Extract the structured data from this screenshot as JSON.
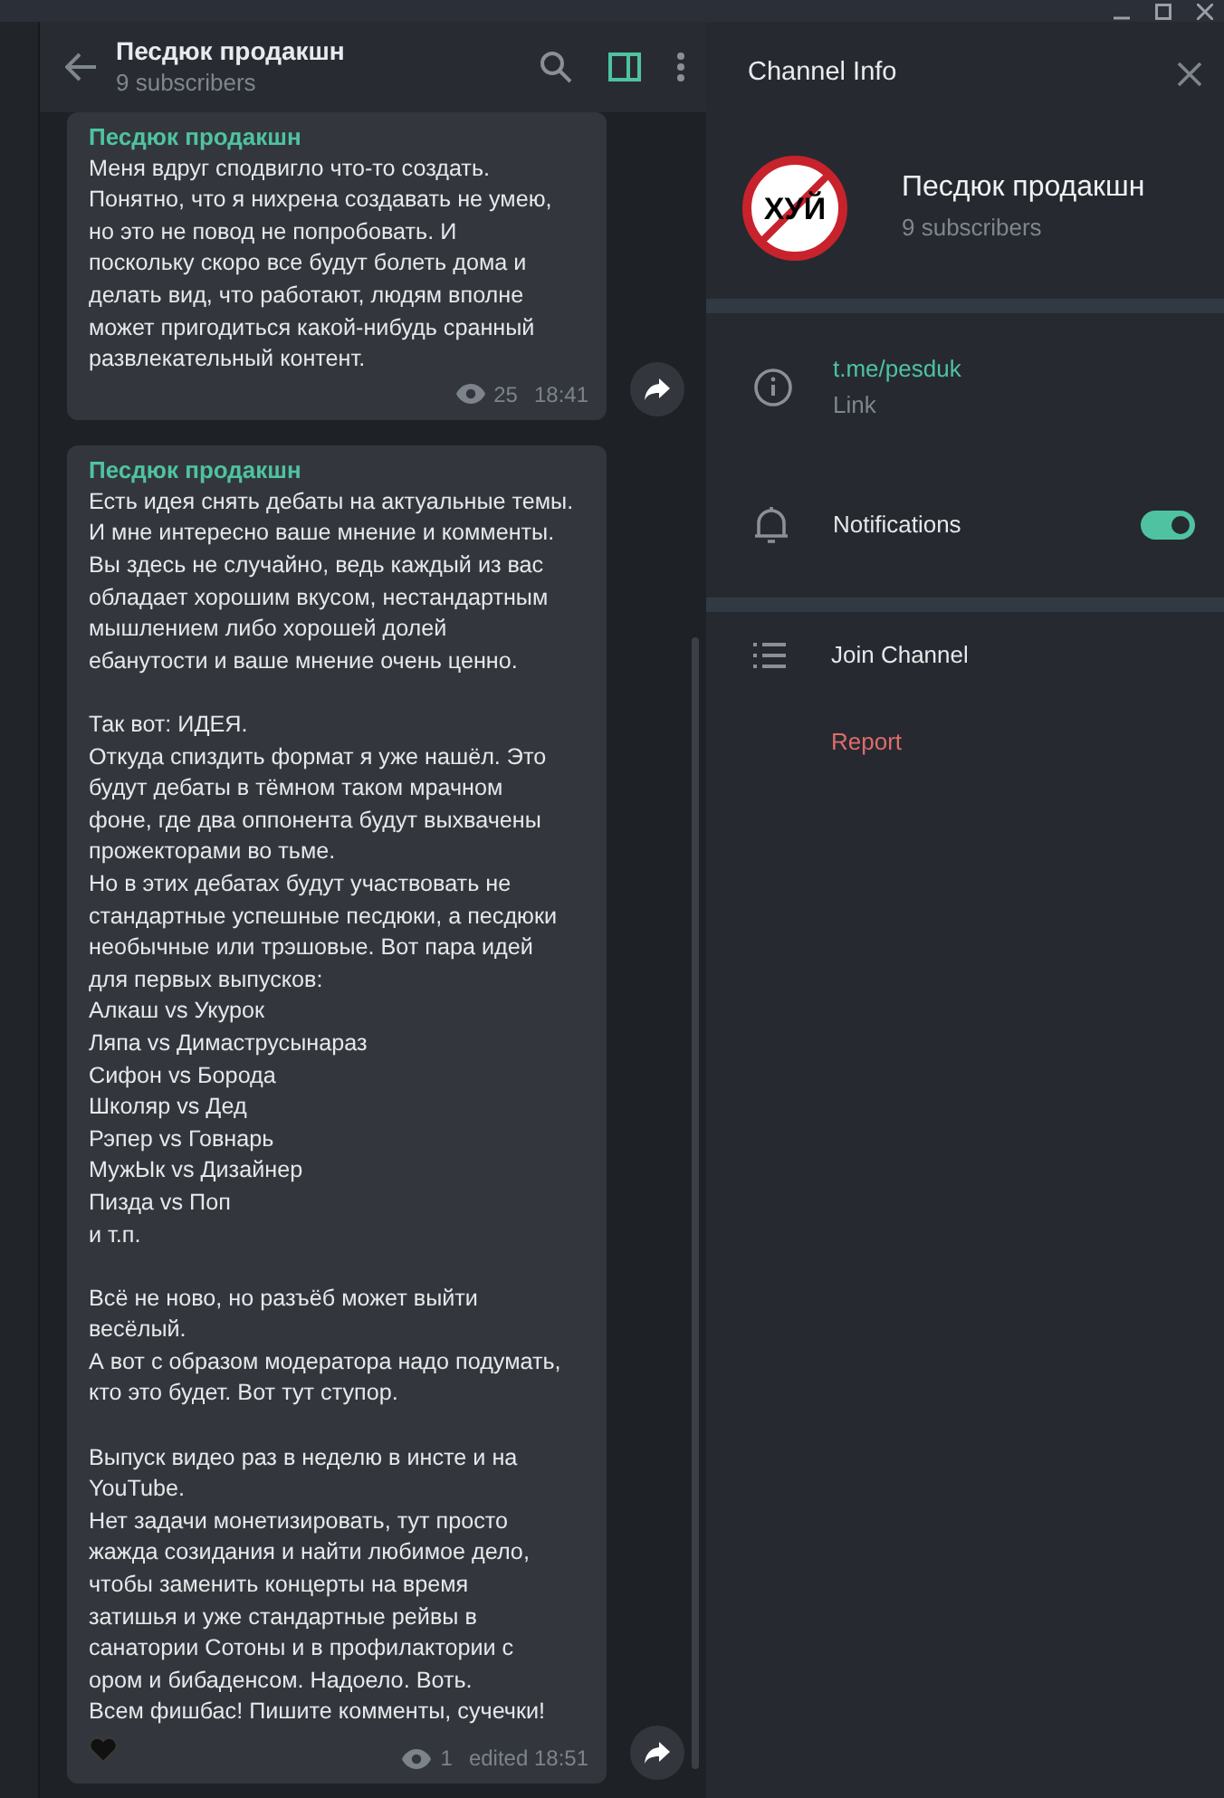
{
  "chat": {
    "title": "Песдюк продакшн",
    "subtitle": "9 subscribers",
    "info_panel_open": true
  },
  "messages": [
    {
      "author": "Песдюк продакшн",
      "text": "Меня вдруг сподвигло что-то создать.\nПонятно, что я нихрена создавать не умею,\nно это не повод не попробовать. И\nпоскольку скоро все будут болеть дома и\nделать вид, что работают, людям вполне\nможет пригодиться какой-нибудь сранный\nразвлекательный контент.",
      "views": "25",
      "time": "18:41",
      "heart": false
    },
    {
      "author": "Песдюк продакшн",
      "text": "Есть идея снять дебаты на актуальные темы.\nИ мне интересно ваше мнение и комменты.\nВы здесь не случайно, ведь каждый из вас\nобладает хорошим вкусом, нестандартным\nмышлением либо хорошей долей\nебанутости и ваше мнение очень ценно.\n\nТак вот: ИДЕЯ.\nОткуда спиздить формат я уже нашёл. Это\nбудут дебаты в тёмном таком мрачном\nфоне, где два оппонента будут выхвачены\nпрожекторами во тьме.\nНо в этих дебатах будут участвовать не\nстандартные успешные песдюки, а песдюки\nнеобычные или трэшовые. Вот пара идей\nдля первых выпусков:\nАлкаш vs Укурок\nЛяпа vs Димаструсынараз\nСифон vs Борода\nШколяр vs Дед\nРэпер vs Говнарь\nМужЫк vs Дизайнер\nПизда vs Поп\nи т.п.\n\nВсё не ново, но разъёб может выйти\nвесёлый.\nА вот с образом модератора надо подумать,\nкто это будет. Вот тут ступор.\n\nВыпуск видео раз в неделю в инсте и на\nYouTube.\nНет задачи монетизировать, тут просто\nжажда созидания и найти любимое дело,\nчтобы заменить концерты на время\nзатишья и уже стандартные рейвы в\nсанатории Сотоны и в профилактории с\nором и бибаденсом. Надоело. Воть.\nВсем фишбас! Пишите комменты, сучечки!",
      "views": "1",
      "time": "edited 18:51",
      "heart": true
    }
  ],
  "panel": {
    "title": "Channel Info",
    "avatar_text": "ХУЙ",
    "name": "Песдюк продакшн",
    "subscribers": "9 subscribers",
    "link": {
      "value": "t.me/pesduk",
      "label": "Link"
    },
    "notifications": {
      "label": "Notifications",
      "on": true
    },
    "actions": [
      {
        "label": "Join Channel",
        "kind": "join"
      },
      {
        "label": "Report",
        "kind": "report"
      }
    ]
  }
}
